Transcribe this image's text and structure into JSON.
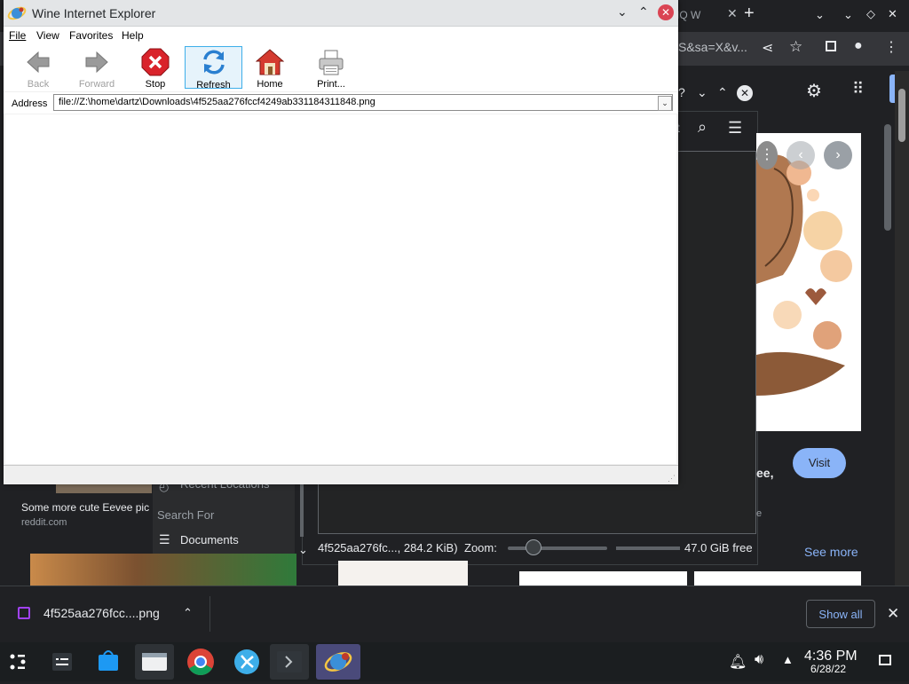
{
  "ie": {
    "title": "Wine Internet Explorer",
    "menu": [
      "File",
      "View",
      "Favorites",
      "Help"
    ],
    "toolbar": {
      "back": "Back",
      "forward": "Forward",
      "stop": "Stop",
      "refresh": "Refresh",
      "home": "Home",
      "print": "Print..."
    },
    "address_label": "Address",
    "address_value": "file://Z:\\home\\dartz\\Downloads\\4f525aa276fccf4249ab331184311848.png"
  },
  "background": {
    "tab_title": "IQ W",
    "url_fragment": "S&sa=X&v...",
    "viewer_partial": "t",
    "snippet_text": "ee,",
    "visit": "Visit",
    "see_more": "See more",
    "status_file": "4f525aa276fc..., 284.2 KiB)",
    "zoom_label": "Zoom:",
    "free_space": "47.0 GiB free",
    "file_dialog": {
      "recent_locations": "Recent Locations",
      "search_for": "Search For",
      "documents": "Documents"
    },
    "caption": "Some more cute Eevee pic",
    "caption_source": "reddit.com"
  },
  "download_shelf": {
    "file_name": "4f525aa276fcc....png",
    "show_all": "Show all"
  },
  "taskbar": {
    "time": "4:36 PM",
    "date": "6/28/22"
  },
  "colors": {
    "accent": "#3daee9",
    "link": "#8ab4f8",
    "download_icon": "#a142f4"
  }
}
